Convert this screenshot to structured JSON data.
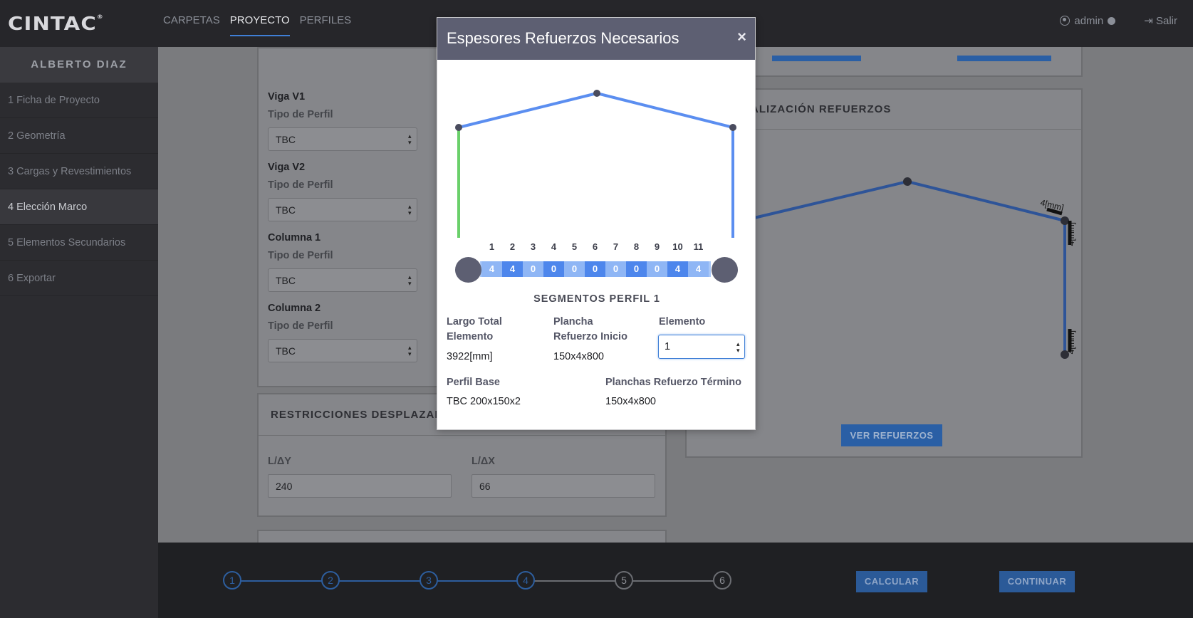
{
  "app": {
    "logo": "CINTAC",
    "logo_mark": "®",
    "nav": [
      "CARPETAS",
      "PROYECTO",
      "PERFILES"
    ],
    "user": "admin",
    "logout": "Salir"
  },
  "sidebar": {
    "project_owner": "ALBERTO DIAZ",
    "items": [
      {
        "label": "1 Ficha de Proyecto"
      },
      {
        "label": "2 Geometría"
      },
      {
        "label": "3 Cargas y Revestimientos"
      },
      {
        "label": "4 Elección Marco"
      },
      {
        "label": "5 Elementos Secundarios"
      },
      {
        "label": "6 Exportar"
      }
    ]
  },
  "profiles_panel": {
    "groups": [
      {
        "title": "Viga V1",
        "label": "Tipo de Perfil",
        "value": "TBC"
      },
      {
        "title": "Viga V2",
        "label": "Tipo de Perfil",
        "value": "TBC"
      },
      {
        "title": "Columna 1",
        "label": "Tipo de Perfil",
        "value": "TBC"
      },
      {
        "title": "Columna 2",
        "label": "Tipo de Perfil",
        "value": "TBC"
      }
    ]
  },
  "restrictions_panel": {
    "title": "RESTRICCIONES DESPLAZAMIE",
    "ly_label": "L/ΔY",
    "ly_value": "240",
    "lx_label": "L/ΔX",
    "lx_value": "66"
  },
  "viz_panel": {
    "title": "ALIZACIÓN REFUERZOS",
    "dim_label": "4[mm]",
    "button": "VER REFUERZOS"
  },
  "footer": {
    "steps": [
      "1",
      "2",
      "3",
      "4",
      "5",
      "6"
    ],
    "completed_steps": 4,
    "calcular": "CALCULAR",
    "continuar": "CONTINUAR"
  },
  "modal": {
    "title": "Espesores Refuerzos Necesarios",
    "close": "×",
    "segment_numbers": [
      "1",
      "2",
      "3",
      "4",
      "5",
      "6",
      "7",
      "8",
      "9",
      "10",
      "11"
    ],
    "segment_values": [
      "4",
      "4",
      "0",
      "0",
      "0",
      "0",
      "0",
      "0",
      "0",
      "4",
      "4"
    ],
    "segments_title": "SEGMENTOS PERFIL 1",
    "largo_label_1": "Largo Total",
    "largo_label_2": "Elemento",
    "largo_value": "3922[mm]",
    "plancha_label_1": "Plancha",
    "plancha_label_2": "Refuerzo Inicio",
    "plancha_value": "150x4x800",
    "elemento_label": "Elemento",
    "elemento_value": "1",
    "perfil_label": "Perfil Base",
    "perfil_value": "TBC 200x150x2",
    "planchas_termino_label": "Planchas Refuerzo Término",
    "planchas_termino_value": "150x4x800",
    "colors": {
      "frame": "#5b8ef0",
      "selected_member": "#6ad06a",
      "node": "#4a4c5e"
    }
  }
}
